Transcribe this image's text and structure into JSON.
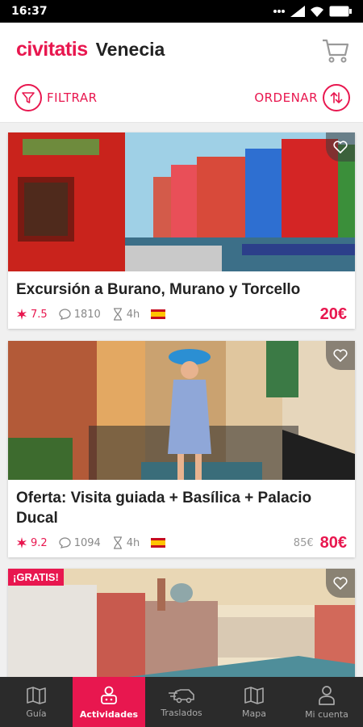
{
  "status_bar": {
    "time": "16:37"
  },
  "header": {
    "brand": "civitatis",
    "city": "Venecia"
  },
  "filters": {
    "filter_label": "FILTRAR",
    "sort_label": "ORDENAR"
  },
  "activities": [
    {
      "title": "Excursión a Burano, Murano y Torcello",
      "rating": "7.5",
      "comments": "1810",
      "duration": "4h",
      "price": "20€",
      "old_price": ""
    },
    {
      "title": "Oferta: Visita guiada + Basílica + Palacio Ducal",
      "rating": "9.2",
      "comments": "1094",
      "duration": "4h",
      "price": "80€",
      "old_price": "85€"
    },
    {
      "badge": "¡GRATIS!"
    }
  ],
  "nav": {
    "items": [
      {
        "label": "Guía"
      },
      {
        "label": "Actividades"
      },
      {
        "label": "Traslados"
      },
      {
        "label": "Mapa"
      },
      {
        "label": "Mi cuenta"
      }
    ],
    "active_index": 1
  },
  "colors": {
    "accent": "#e8174f",
    "nav_bg": "#2b2b2b"
  }
}
